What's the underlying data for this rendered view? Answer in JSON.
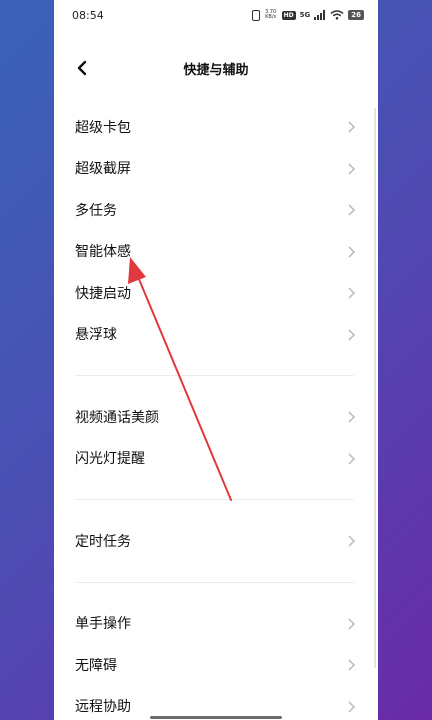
{
  "status_bar": {
    "time": "08:54",
    "network_speed": "3.70 KB/s",
    "hd_badge": "HD",
    "network_type": "5G",
    "battery_level": "26"
  },
  "header": {
    "title": "快捷与辅助"
  },
  "menu": {
    "group1": [
      {
        "label": "超级卡包"
      },
      {
        "label": "超级截屏"
      },
      {
        "label": "多任务"
      },
      {
        "label": "智能体感"
      },
      {
        "label": "快捷启动"
      },
      {
        "label": "悬浮球"
      }
    ],
    "group2": [
      {
        "label": "视频通话美颜"
      },
      {
        "label": "闪光灯提醒"
      }
    ],
    "group3": [
      {
        "label": "定时任务"
      }
    ],
    "group4": [
      {
        "label": "单手操作"
      },
      {
        "label": "无障碍"
      },
      {
        "label": "远程协助"
      }
    ]
  },
  "colors": {
    "annotation_arrow": "#e0393e",
    "background_gradient_start": "#3a63b8",
    "background_gradient_end": "#6a2aa8"
  }
}
